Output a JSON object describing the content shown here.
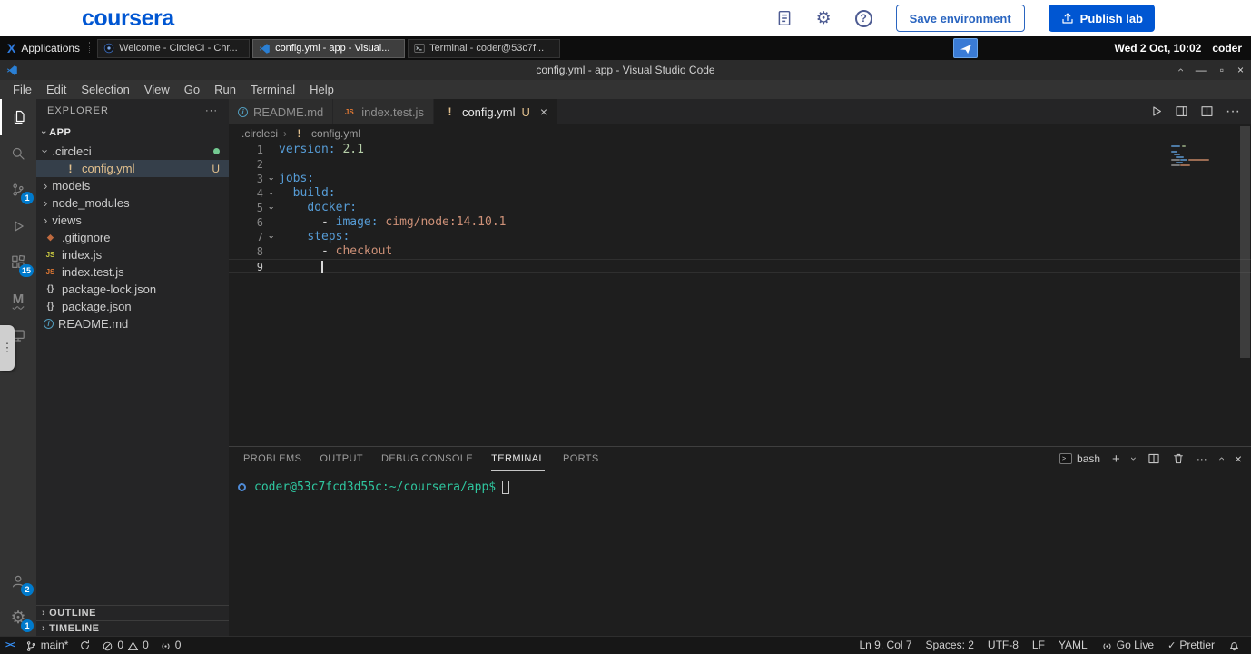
{
  "coursera": {
    "logo": "coursera",
    "save_button": "Save environment",
    "publish_button": "Publish lab"
  },
  "taskbar": {
    "applications_label": "Applications",
    "windows": [
      {
        "label": "Welcome - CircleCI - Chr...",
        "icon": "circleci",
        "active": false
      },
      {
        "label": "config.yml - app - Visual...",
        "icon": "vscode",
        "active": true
      },
      {
        "label": "Terminal - coder@53c7f...",
        "icon": "termwin",
        "active": false
      }
    ],
    "clock": "Wed 2 Oct, 10:02",
    "username": "coder"
  },
  "window": {
    "title": "config.yml - app - Visual Studio Code"
  },
  "menu": {
    "items": [
      "File",
      "Edit",
      "Selection",
      "View",
      "Go",
      "Run",
      "Terminal",
      "Help"
    ]
  },
  "activity": {
    "badges": {
      "scm": "1",
      "extensions": "15",
      "accounts": "2",
      "settings": "1"
    }
  },
  "explorer": {
    "title": "EXPLORER",
    "root": "APP",
    "items": [
      {
        "label": ".circleci",
        "type": "folder",
        "expanded": true,
        "level": 1,
        "dot": true
      },
      {
        "label": "config.yml",
        "type": "file",
        "icon": "yaml",
        "level": 2,
        "selected": true,
        "badge": "U"
      },
      {
        "label": "models",
        "type": "folder",
        "level": 1
      },
      {
        "label": "node_modules",
        "type": "folder",
        "level": 1
      },
      {
        "label": "views",
        "type": "folder",
        "level": 1
      },
      {
        "label": ".gitignore",
        "type": "file",
        "icon": "gitignore",
        "level": 1
      },
      {
        "label": "index.js",
        "type": "file",
        "icon": "js",
        "level": 1
      },
      {
        "label": "index.test.js",
        "type": "file",
        "icon": "js-test",
        "level": 1
      },
      {
        "label": "package-lock.json",
        "type": "file",
        "icon": "json",
        "level": 1
      },
      {
        "label": "package.json",
        "type": "file",
        "icon": "json",
        "level": 1
      },
      {
        "label": "README.md",
        "type": "file",
        "icon": "info",
        "level": 1
      }
    ],
    "sections": [
      "OUTLINE",
      "TIMELINE"
    ]
  },
  "tabs": [
    {
      "label": "README.md",
      "icon": "info",
      "active": false
    },
    {
      "label": "index.test.js",
      "icon": "js-test",
      "active": false
    },
    {
      "label": "config.yml",
      "icon": "yaml",
      "badge": "U",
      "active": true,
      "closable": true
    }
  ],
  "breadcrumb": {
    "folder": ".circleci",
    "file": "config.yml"
  },
  "code": {
    "language": "yaml",
    "colors": {
      "key": "#569cd6",
      "str": "#ce9178",
      "num": "#b5cea8",
      "plain": "#d4d4d4"
    },
    "lines": [
      {
        "n": 1,
        "tokens": [
          [
            "key",
            "version:"
          ],
          [
            "plain",
            " "
          ],
          [
            "num",
            "2.1"
          ]
        ]
      },
      {
        "n": 2,
        "tokens": []
      },
      {
        "n": 3,
        "fold": true,
        "tokens": [
          [
            "key",
            "jobs:"
          ]
        ]
      },
      {
        "n": 4,
        "fold": true,
        "tokens": [
          [
            "plain",
            "  "
          ],
          [
            "key",
            "build:"
          ]
        ]
      },
      {
        "n": 5,
        "fold": true,
        "tokens": [
          [
            "plain",
            "    "
          ],
          [
            "key",
            "docker:"
          ]
        ]
      },
      {
        "n": 6,
        "tokens": [
          [
            "plain",
            "      - "
          ],
          [
            "key",
            "image:"
          ],
          [
            "plain",
            " "
          ],
          [
            "str",
            "cimg/node:14.10.1"
          ]
        ]
      },
      {
        "n": 7,
        "fold": true,
        "tokens": [
          [
            "plain",
            "    "
          ],
          [
            "key",
            "steps:"
          ]
        ]
      },
      {
        "n": 8,
        "tokens": [
          [
            "plain",
            "      - "
          ],
          [
            "str",
            "checkout"
          ]
        ]
      },
      {
        "n": 9,
        "current": true,
        "cursor_col": 7,
        "tokens": [
          [
            "plain",
            "      "
          ]
        ]
      }
    ]
  },
  "panel": {
    "tabs": [
      {
        "label": "PROBLEMS",
        "active": false
      },
      {
        "label": "OUTPUT",
        "active": false
      },
      {
        "label": "DEBUG CONSOLE",
        "active": false
      },
      {
        "label": "TERMINAL",
        "active": true
      },
      {
        "label": "PORTS",
        "active": false
      }
    ],
    "shell_label": "bash",
    "terminal": {
      "prompt": "coder@53c7fcd3d55c:~/coursera/app$",
      "prompt_color": "#2fc7a0"
    }
  },
  "status": {
    "left": {
      "branch": "main*",
      "errors": "0",
      "warnings": "0",
      "ports": "0"
    },
    "right": {
      "line_col": "Ln 9, Col 7",
      "indent": "Spaces: 2",
      "encoding": "UTF-8",
      "eol": "LF",
      "language": "YAML",
      "go_live": "Go Live",
      "formatter": "Prettier"
    }
  },
  "colors": {
    "coursera_blue": "#0056d2",
    "badge_blue": "#007acc",
    "untracked_tan": "#e2c08d",
    "git_dot_green": "#73c991"
  }
}
